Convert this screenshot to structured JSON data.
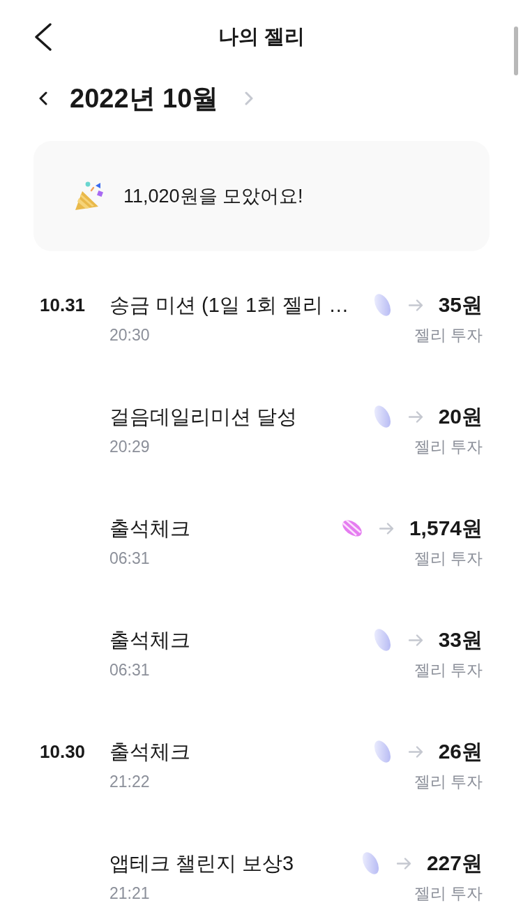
{
  "header": {
    "title": "나의 젤리"
  },
  "month": {
    "label": "2022년 10월",
    "prev": {
      "disabled": false
    },
    "next": {
      "disabled": true
    }
  },
  "summary": {
    "text": "11,020원을 모았어요!"
  },
  "entries": [
    {
      "date": "10.31",
      "title": "송금 미션 (1일 1회 젤리 …",
      "time": "20:30",
      "kind": "plain",
      "amount": "35원",
      "note": "젤리 투자"
    },
    {
      "title": "걸음데일리미션 달성",
      "time": "20:29",
      "kind": "plain",
      "amount": "20원",
      "note": "젤리 투자"
    },
    {
      "title": "출석체크",
      "time": "06:31",
      "kind": "striped",
      "amount": "1,574원",
      "note": "젤리 투자"
    },
    {
      "title": "출석체크",
      "time": "06:31",
      "kind": "plain",
      "amount": "33원",
      "note": "젤리 투자"
    },
    {
      "date": "10.30",
      "title": "출석체크",
      "time": "21:22",
      "kind": "plain",
      "amount": "26원",
      "note": "젤리 투자"
    },
    {
      "title": "앱테크 챌린지 보상3",
      "time": "21:21",
      "kind": "plain",
      "amount": "227원",
      "note": "젤리 투자"
    }
  ]
}
